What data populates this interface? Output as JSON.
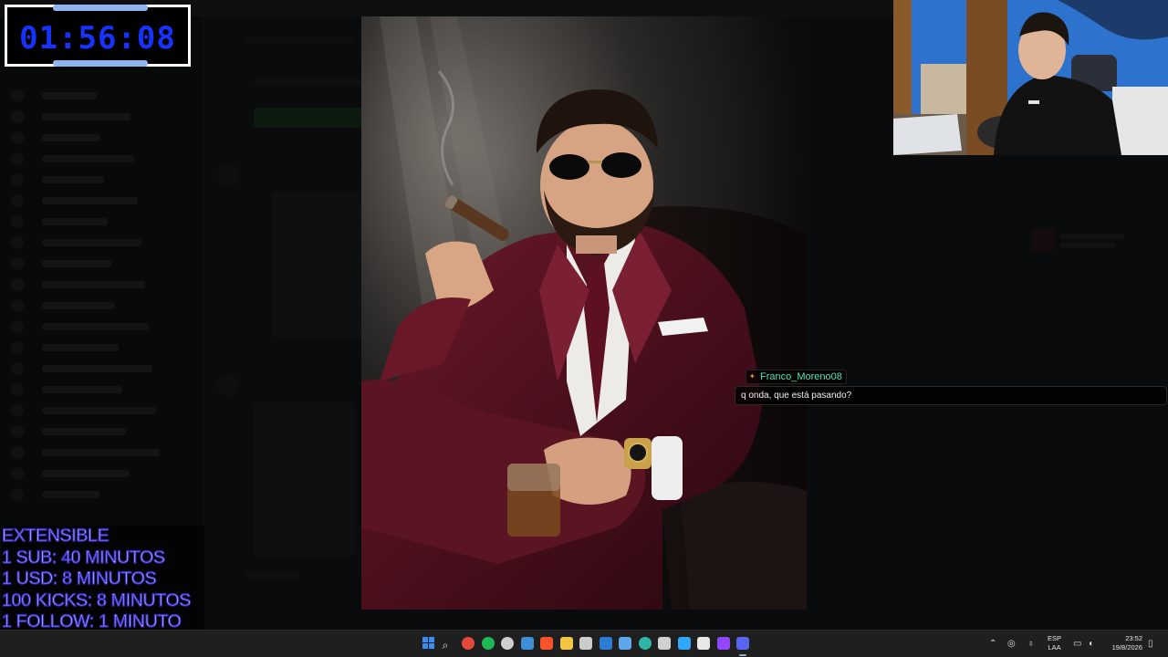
{
  "timer": {
    "display": "01:56:08"
  },
  "chat": {
    "username": "Franco_Moreno08",
    "message": "q onda, que está pasando?"
  },
  "extensible": {
    "lines": [
      "EXTENSIBLE",
      "1 SUB: 40 MINUTOS",
      "1 USD: 8 MINUTOS",
      "100 KICKS: 8 MINUTOS",
      "1 FOLLOW: 1 MINUTO"
    ]
  },
  "taskbar": {
    "language": {
      "line1": "ESP",
      "line2": "LAA"
    },
    "clock": {
      "time": "23:52",
      "date": "19/8/2026"
    },
    "apps": [
      {
        "name": "start-icon",
        "color": "#3c8cf0"
      },
      {
        "name": "search-icon",
        "color": "#d8d8d8"
      },
      {
        "name": "chrome-icon",
        "color": "#e2493b"
      },
      {
        "name": "spotify-icon",
        "color": "#1db954"
      },
      {
        "name": "obs-icon",
        "color": "#cfcfcf"
      },
      {
        "name": "steam-icon",
        "color": "#3f8fd6"
      },
      {
        "name": "brave-icon",
        "color": "#fb542b"
      },
      {
        "name": "file-explorer-icon",
        "color": "#f4c542"
      },
      {
        "name": "app-icon",
        "color": "#cccccc"
      },
      {
        "name": "word-icon",
        "color": "#2b7cd3"
      },
      {
        "name": "app2-icon",
        "color": "#5fa7e8"
      },
      {
        "name": "edge-icon",
        "color": "#2fb5a6"
      },
      {
        "name": "calculator-icon",
        "color": "#d0d0d0"
      },
      {
        "name": "photoshop-icon",
        "color": "#31a8ff"
      },
      {
        "name": "capcut-icon",
        "color": "#e8e8e8"
      },
      {
        "name": "twitch-icon",
        "color": "#9146ff"
      },
      {
        "name": "discord-icon",
        "color": "#5865f2"
      }
    ]
  }
}
